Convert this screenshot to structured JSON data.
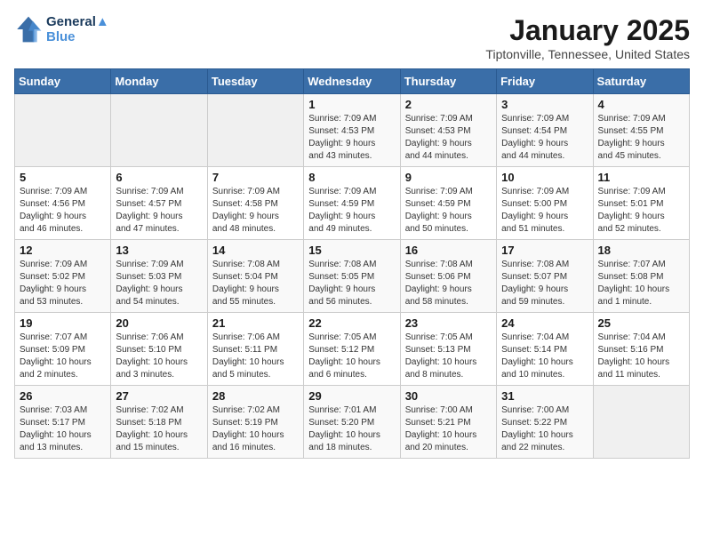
{
  "header": {
    "logo_line1": "General",
    "logo_line2": "Blue",
    "month": "January 2025",
    "location": "Tiptonville, Tennessee, United States"
  },
  "weekdays": [
    "Sunday",
    "Monday",
    "Tuesday",
    "Wednesday",
    "Thursday",
    "Friday",
    "Saturday"
  ],
  "weeks": [
    [
      {
        "day": "",
        "detail": ""
      },
      {
        "day": "",
        "detail": ""
      },
      {
        "day": "",
        "detail": ""
      },
      {
        "day": "1",
        "detail": "Sunrise: 7:09 AM\nSunset: 4:53 PM\nDaylight: 9 hours\nand 43 minutes."
      },
      {
        "day": "2",
        "detail": "Sunrise: 7:09 AM\nSunset: 4:53 PM\nDaylight: 9 hours\nand 44 minutes."
      },
      {
        "day": "3",
        "detail": "Sunrise: 7:09 AM\nSunset: 4:54 PM\nDaylight: 9 hours\nand 44 minutes."
      },
      {
        "day": "4",
        "detail": "Sunrise: 7:09 AM\nSunset: 4:55 PM\nDaylight: 9 hours\nand 45 minutes."
      }
    ],
    [
      {
        "day": "5",
        "detail": "Sunrise: 7:09 AM\nSunset: 4:56 PM\nDaylight: 9 hours\nand 46 minutes."
      },
      {
        "day": "6",
        "detail": "Sunrise: 7:09 AM\nSunset: 4:57 PM\nDaylight: 9 hours\nand 47 minutes."
      },
      {
        "day": "7",
        "detail": "Sunrise: 7:09 AM\nSunset: 4:58 PM\nDaylight: 9 hours\nand 48 minutes."
      },
      {
        "day": "8",
        "detail": "Sunrise: 7:09 AM\nSunset: 4:59 PM\nDaylight: 9 hours\nand 49 minutes."
      },
      {
        "day": "9",
        "detail": "Sunrise: 7:09 AM\nSunset: 4:59 PM\nDaylight: 9 hours\nand 50 minutes."
      },
      {
        "day": "10",
        "detail": "Sunrise: 7:09 AM\nSunset: 5:00 PM\nDaylight: 9 hours\nand 51 minutes."
      },
      {
        "day": "11",
        "detail": "Sunrise: 7:09 AM\nSunset: 5:01 PM\nDaylight: 9 hours\nand 52 minutes."
      }
    ],
    [
      {
        "day": "12",
        "detail": "Sunrise: 7:09 AM\nSunset: 5:02 PM\nDaylight: 9 hours\nand 53 minutes."
      },
      {
        "day": "13",
        "detail": "Sunrise: 7:09 AM\nSunset: 5:03 PM\nDaylight: 9 hours\nand 54 minutes."
      },
      {
        "day": "14",
        "detail": "Sunrise: 7:08 AM\nSunset: 5:04 PM\nDaylight: 9 hours\nand 55 minutes."
      },
      {
        "day": "15",
        "detail": "Sunrise: 7:08 AM\nSunset: 5:05 PM\nDaylight: 9 hours\nand 56 minutes."
      },
      {
        "day": "16",
        "detail": "Sunrise: 7:08 AM\nSunset: 5:06 PM\nDaylight: 9 hours\nand 58 minutes."
      },
      {
        "day": "17",
        "detail": "Sunrise: 7:08 AM\nSunset: 5:07 PM\nDaylight: 9 hours\nand 59 minutes."
      },
      {
        "day": "18",
        "detail": "Sunrise: 7:07 AM\nSunset: 5:08 PM\nDaylight: 10 hours\nand 1 minute."
      }
    ],
    [
      {
        "day": "19",
        "detail": "Sunrise: 7:07 AM\nSunset: 5:09 PM\nDaylight: 10 hours\nand 2 minutes."
      },
      {
        "day": "20",
        "detail": "Sunrise: 7:06 AM\nSunset: 5:10 PM\nDaylight: 10 hours\nand 3 minutes."
      },
      {
        "day": "21",
        "detail": "Sunrise: 7:06 AM\nSunset: 5:11 PM\nDaylight: 10 hours\nand 5 minutes."
      },
      {
        "day": "22",
        "detail": "Sunrise: 7:05 AM\nSunset: 5:12 PM\nDaylight: 10 hours\nand 6 minutes."
      },
      {
        "day": "23",
        "detail": "Sunrise: 7:05 AM\nSunset: 5:13 PM\nDaylight: 10 hours\nand 8 minutes."
      },
      {
        "day": "24",
        "detail": "Sunrise: 7:04 AM\nSunset: 5:14 PM\nDaylight: 10 hours\nand 10 minutes."
      },
      {
        "day": "25",
        "detail": "Sunrise: 7:04 AM\nSunset: 5:16 PM\nDaylight: 10 hours\nand 11 minutes."
      }
    ],
    [
      {
        "day": "26",
        "detail": "Sunrise: 7:03 AM\nSunset: 5:17 PM\nDaylight: 10 hours\nand 13 minutes."
      },
      {
        "day": "27",
        "detail": "Sunrise: 7:02 AM\nSunset: 5:18 PM\nDaylight: 10 hours\nand 15 minutes."
      },
      {
        "day": "28",
        "detail": "Sunrise: 7:02 AM\nSunset: 5:19 PM\nDaylight: 10 hours\nand 16 minutes."
      },
      {
        "day": "29",
        "detail": "Sunrise: 7:01 AM\nSunset: 5:20 PM\nDaylight: 10 hours\nand 18 minutes."
      },
      {
        "day": "30",
        "detail": "Sunrise: 7:00 AM\nSunset: 5:21 PM\nDaylight: 10 hours\nand 20 minutes."
      },
      {
        "day": "31",
        "detail": "Sunrise: 7:00 AM\nSunset: 5:22 PM\nDaylight: 10 hours\nand 22 minutes."
      },
      {
        "day": "",
        "detail": ""
      }
    ]
  ]
}
